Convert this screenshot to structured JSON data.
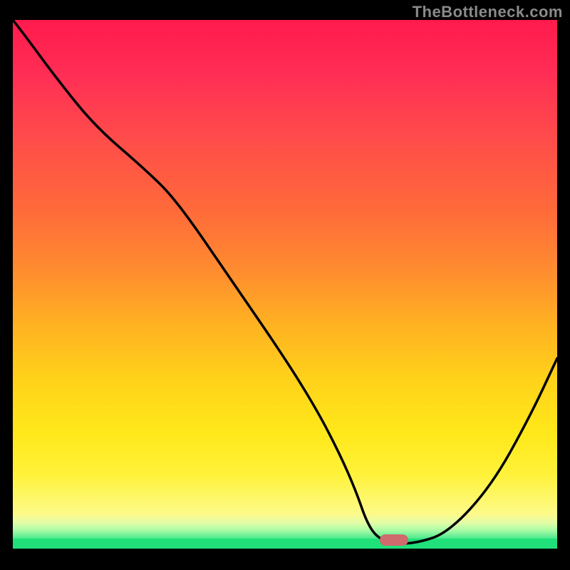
{
  "watermark": "TheBottleneck.com",
  "chart_data": {
    "type": "line",
    "title": "",
    "xlabel": "",
    "ylabel": "",
    "xlim": [
      0,
      100
    ],
    "ylim": [
      0,
      100
    ],
    "x": [
      0,
      3,
      8,
      15,
      24,
      30,
      40,
      50,
      56,
      60,
      63,
      65,
      67,
      70,
      74,
      80,
      88,
      95,
      100
    ],
    "values": [
      100,
      96,
      89,
      80,
      72,
      66,
      51,
      36,
      26,
      18,
      11,
      5,
      2,
      1,
      1,
      3,
      12,
      25,
      36
    ],
    "optimum_x": 70,
    "optimum_y": 1,
    "marker_color": "#cf6a6d",
    "green_level": 2,
    "gradient_stops": [
      {
        "pos": 0,
        "color": "#ff1a4d"
      },
      {
        "pos": 22,
        "color": "#ff4b4b"
      },
      {
        "pos": 48,
        "color": "#ff8e2e"
      },
      {
        "pos": 68,
        "color": "#ffd21a"
      },
      {
        "pos": 94,
        "color": "#fdfb90"
      },
      {
        "pos": 100,
        "color": "#20e07a"
      }
    ]
  }
}
